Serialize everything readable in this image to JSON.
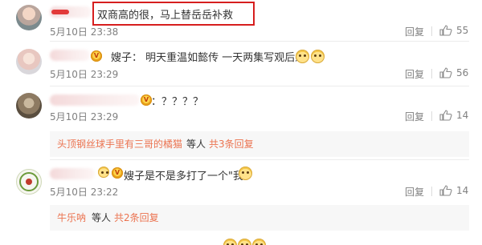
{
  "comments": [
    {
      "text": "双商高的很，马上替岳岳补救",
      "date": "5月10日 23:38",
      "reply_label": "回复",
      "likes": "55"
    },
    {
      "text": "嫂子： 明天重温如懿传   一天两集写观后感",
      "date": "5月10日 23:29",
      "reply_label": "回复",
      "likes": "56"
    },
    {
      "text": "：？？？？",
      "date": "5月10日 23:29",
      "reply_label": "回复",
      "likes": "14",
      "subreply": {
        "name": "头顶钢丝球手里有三哥的橘猫",
        "mid": "等人",
        "count": "共3条回复"
      }
    },
    {
      "text": "嫂子是不是多打了一个\"我\"",
      "date": "5月10日 23:22",
      "reply_label": "回复",
      "likes": "14",
      "subreply": {
        "name": "牛乐呐",
        "mid": "等人",
        "count": "共2条回复"
      }
    }
  ],
  "colors": {
    "highlight": "#d61e1e",
    "link": "#eb7350",
    "meta": "#808080"
  },
  "icons": {
    "like": "thumbs-up-icon",
    "vip": "vip-badge-icon",
    "emoji": "smiley-emoji-icon"
  }
}
